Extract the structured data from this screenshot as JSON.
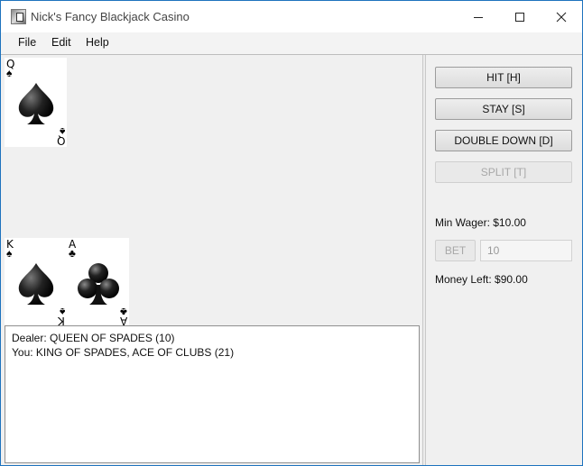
{
  "window": {
    "title": "Nick's Fancy Blackjack Casino"
  },
  "menu": {
    "items": [
      "File",
      "Edit",
      "Help"
    ]
  },
  "dealer": {
    "cards": [
      {
        "rank": "Q",
        "suit": "♠",
        "suit_name": "spade-icon"
      }
    ]
  },
  "player": {
    "cards": [
      {
        "rank": "K",
        "suit": "♠",
        "suit_name": "spade-icon"
      },
      {
        "rank": "A",
        "suit": "♣",
        "suit_name": "club-icon"
      }
    ]
  },
  "log": {
    "lines": [
      "Dealer: QUEEN OF SPADES (10)",
      "You: KING OF SPADES, ACE OF CLUBS (21)"
    ]
  },
  "controls": {
    "hit_label": "HIT [H]",
    "stay_label": "STAY [S]",
    "double_label": "DOUBLE DOWN [D]",
    "split_label": "SPLIT [T]",
    "min_wager": "Min Wager: $10.00",
    "bet_label": "BET",
    "bet_value": "10",
    "money_left": "Money Left: $90.00"
  }
}
